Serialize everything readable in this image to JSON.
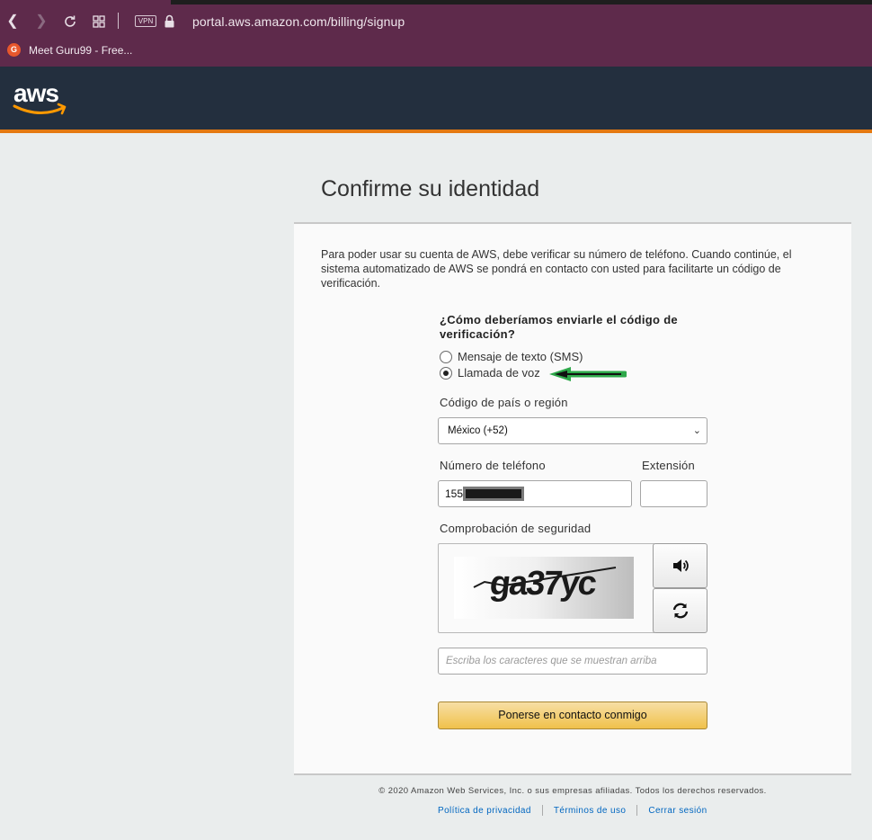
{
  "browser": {
    "url": "portal.aws.amazon.com/billing/signup",
    "vpn_label": "VPN",
    "bookmark_label": "Meet Guru99 - Free...",
    "bookmark_icon_text": "G"
  },
  "header": {
    "logo_text": "aws",
    "colors": {
      "background": "#232f3e",
      "accent": "#e47911"
    }
  },
  "page": {
    "title": "Confirme su identidad",
    "intro": "Para poder usar su cuenta de AWS, debe verificar su número de teléfono. Cuando continúe, el sistema automatizado de AWS se pondrá en contacto con usted para facilitarte un código de verificación."
  },
  "form": {
    "question": "¿Cómo deberíamos enviarle el código de verificación?",
    "options": [
      {
        "label": "Mensaje de texto (SMS)",
        "selected": false
      },
      {
        "label": "Llamada de voz",
        "selected": true
      }
    ],
    "country_label": "Código de país o región",
    "country_value": "México (+52)",
    "phone_label": "Número de teléfono",
    "phone_value": "155",
    "extension_label": "Extensión",
    "extension_value": "",
    "security_label": "Comprobación de seguridad",
    "captcha_text": "ga37yc",
    "captcha_placeholder": "Escriba los caracteres que se muestran arriba",
    "submit_label": "Ponerse en contacto conmigo"
  },
  "footer": {
    "copyright": "© 2020 Amazon Web Services, Inc. o sus empresas afiliadas. Todos los derechos reservados.",
    "links": [
      "Política de privacidad",
      "Términos de uso",
      "Cerrar sesión"
    ]
  }
}
